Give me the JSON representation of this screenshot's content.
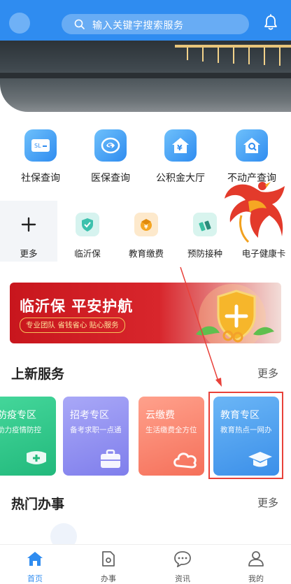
{
  "header": {
    "search_placeholder": "输入关键字搜索服务"
  },
  "row1": [
    {
      "label": "社保查询",
      "icon": "social-security-card-icon"
    },
    {
      "label": "医保查询",
      "icon": "medical-insurance-icon"
    },
    {
      "label": "公积金大厅",
      "icon": "housing-fund-icon"
    },
    {
      "label": "不动产查询",
      "icon": "real-estate-search-icon"
    }
  ],
  "row2": [
    {
      "label": "更多",
      "icon": "plus-icon"
    },
    {
      "label": "临沂保",
      "icon": "shield-check-icon"
    },
    {
      "label": "教育缴费",
      "icon": "education-payment-icon"
    },
    {
      "label": "预防接种",
      "icon": "vaccine-icon"
    },
    {
      "label": "电子健康卡",
      "icon": "health-card-icon"
    }
  ],
  "banner": {
    "title": "临沂保 平安护航",
    "subtitle": "专业团队 省钱省心 贴心服务"
  },
  "new_services": {
    "title": "上新服务",
    "more": "更多",
    "cards": [
      {
        "title": "防疫专区",
        "subtitle": "助力疫情防控",
        "color": "#2fc08a"
      },
      {
        "title": "招考专区",
        "subtitle": "备考求职一点通",
        "color": "#8f8ef0"
      },
      {
        "title": "云缴费",
        "subtitle": "生活缴费全方位",
        "color": "#f7806a"
      },
      {
        "title": "教育专区",
        "subtitle": "教育热点一网办",
        "color": "#4fa3f2"
      }
    ]
  },
  "hot_services": {
    "title": "热门办事",
    "more": "更多"
  },
  "nav": [
    {
      "label": "首页",
      "icon": "home-icon",
      "active": true
    },
    {
      "label": "办事",
      "icon": "document-icon",
      "active": false
    },
    {
      "label": "资讯",
      "icon": "chat-icon",
      "active": false
    },
    {
      "label": "我的",
      "icon": "user-icon",
      "active": false
    }
  ],
  "colors": {
    "primary": "#2f8cf0",
    "highlight": "#e8413a",
    "banner": "#c8161d"
  }
}
